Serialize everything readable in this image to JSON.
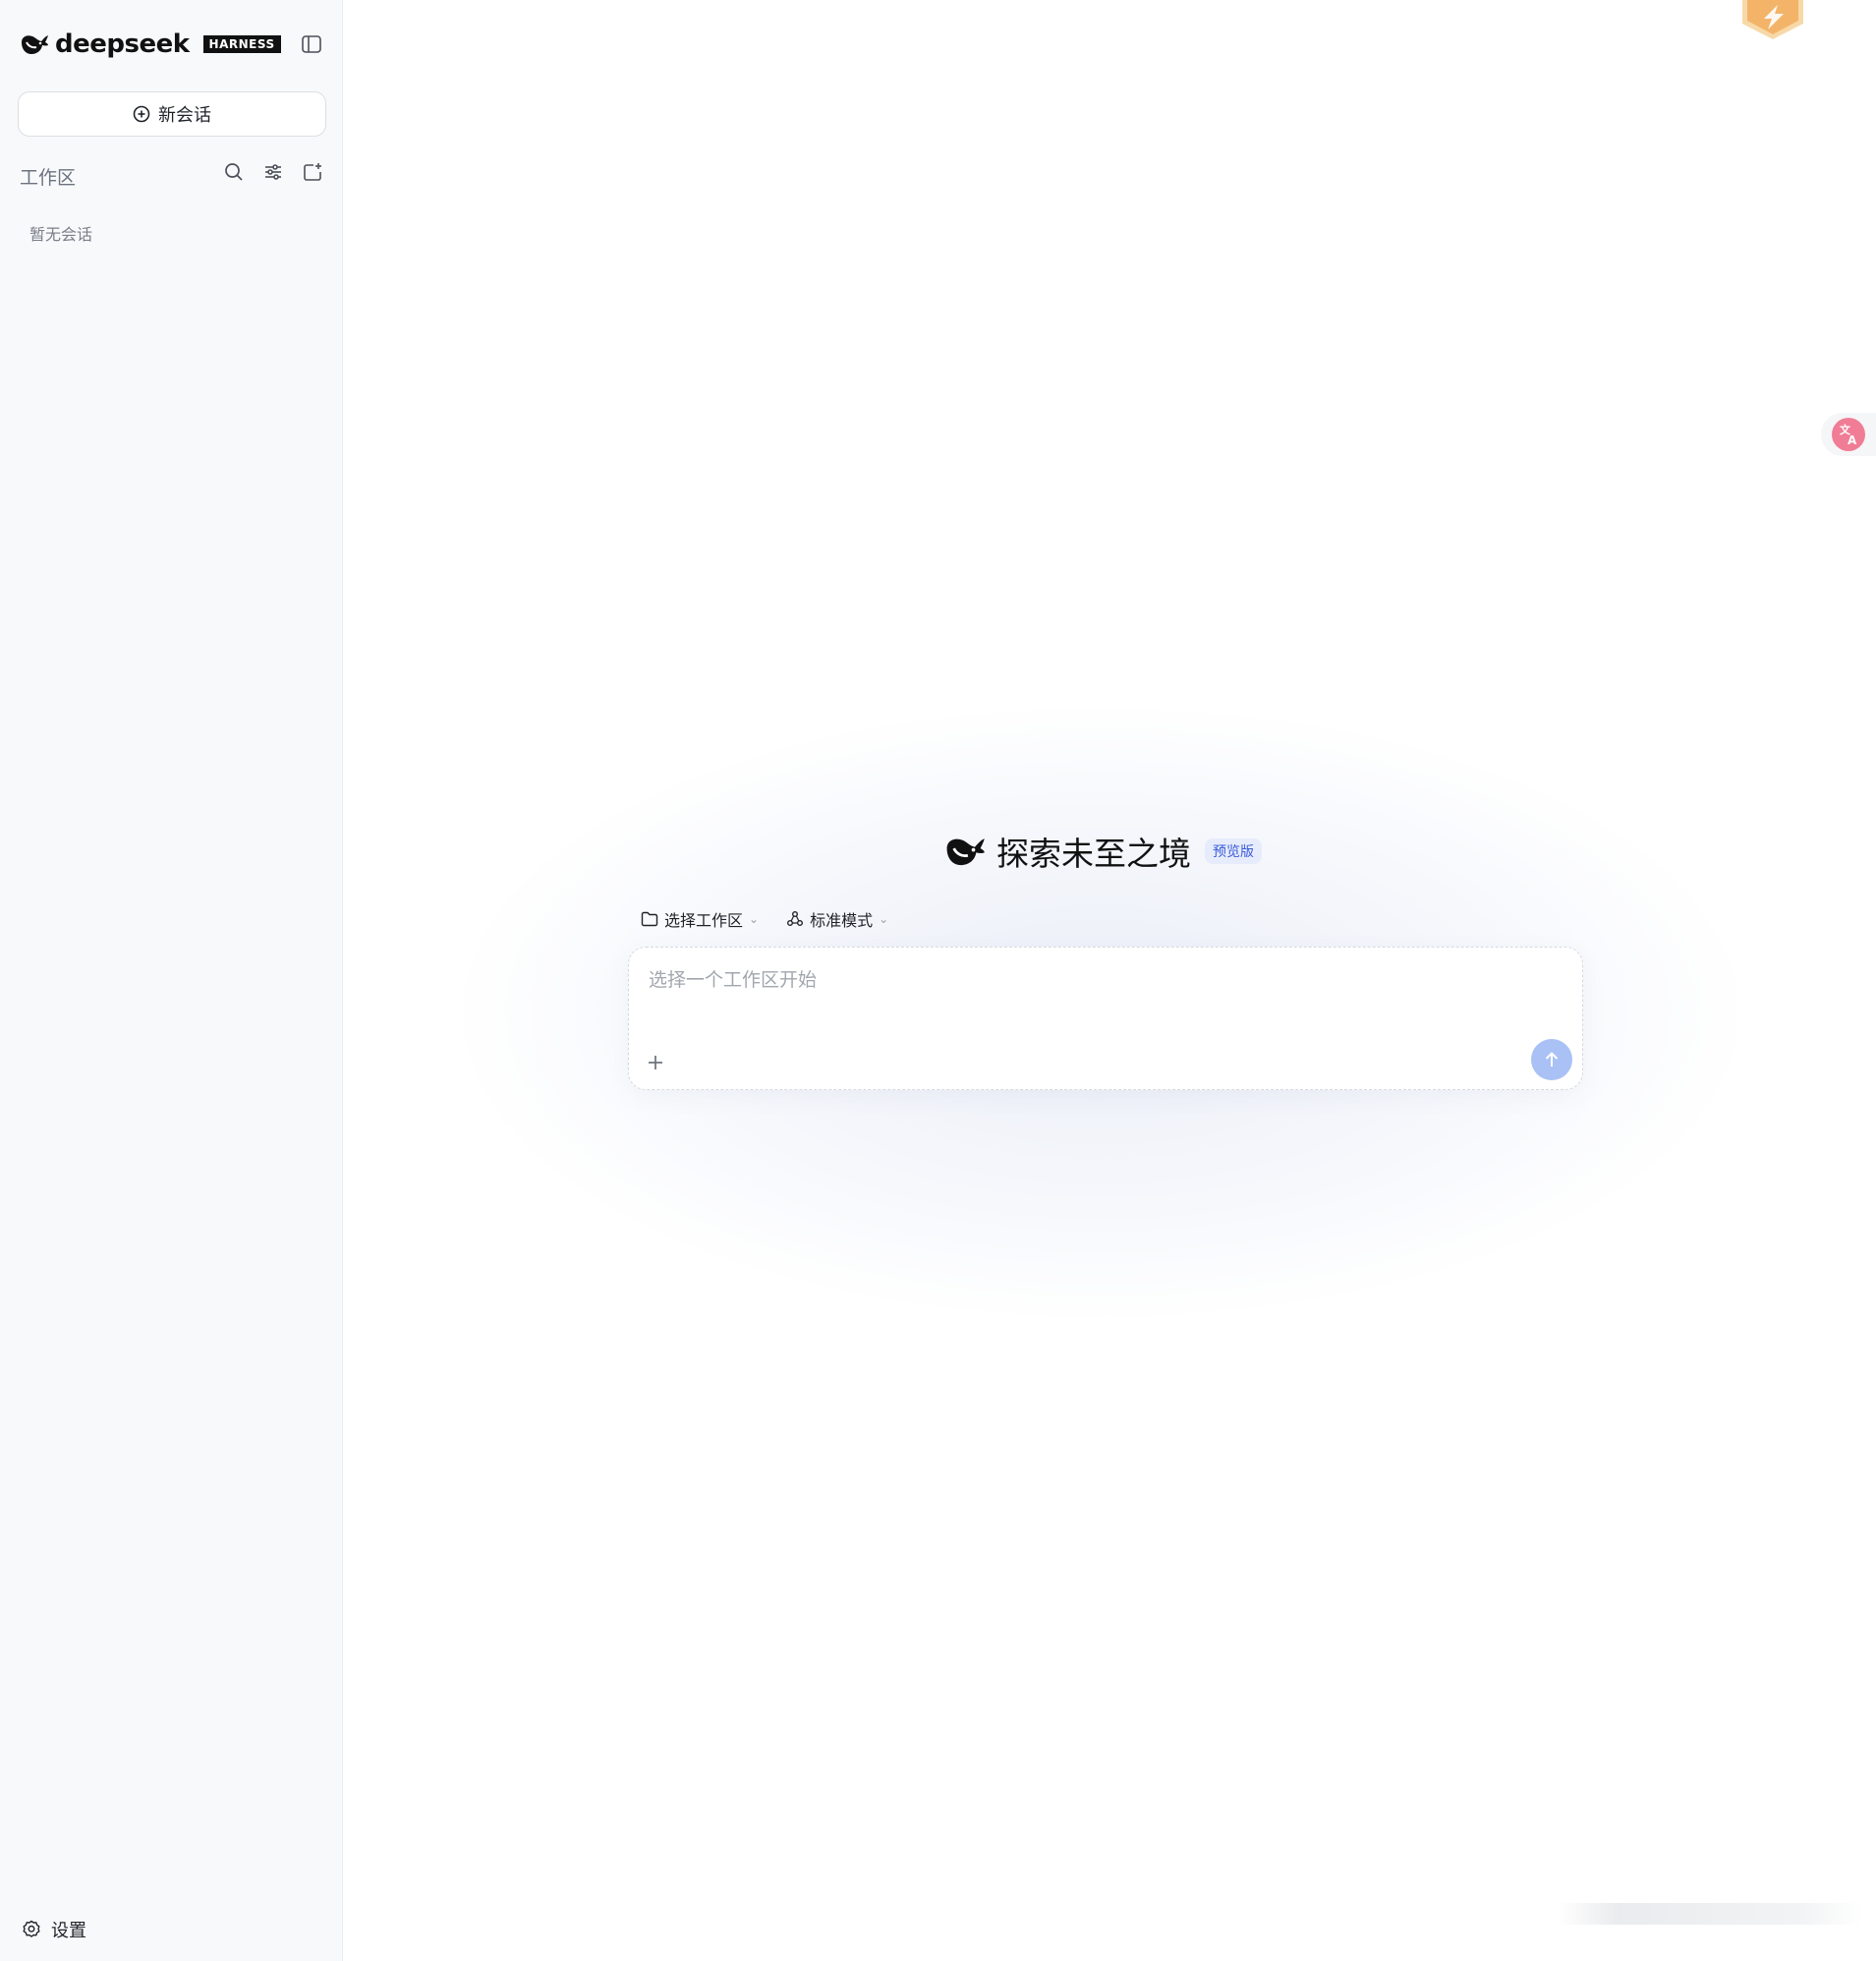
{
  "app": {
    "logo_text": "deepseek",
    "logo_badge": "HARNESS"
  },
  "sidebar": {
    "new_chat_label": "新会话",
    "workspace_label": "工作区",
    "empty_text": "暂无会话",
    "settings_label": "设置"
  },
  "main": {
    "hero_title": "探索未至之境",
    "hero_badge": "预览版",
    "workspace_select_label": "选择工作区",
    "mode_select_label": "标准模式",
    "composer_placeholder": "选择一个工作区开始"
  },
  "colors": {
    "accent": "#a9c1f5",
    "sidebar_bg": "#f8f9fb",
    "badge_bg": "#e6ecfb",
    "badge_fg": "#3b5bdb",
    "translate_icon": "#f07c95",
    "top_badge": "#f3b46a"
  },
  "icons": [
    "deepseek-whale-icon",
    "sidebar-toggle-icon",
    "plus-circle-icon",
    "search-icon",
    "filter-icon",
    "new-folder-icon",
    "gear-icon",
    "folder-icon",
    "mode-icon",
    "chevron-down-icon",
    "plus-icon",
    "arrow-up-icon",
    "translate-icon",
    "badge-icon"
  ]
}
